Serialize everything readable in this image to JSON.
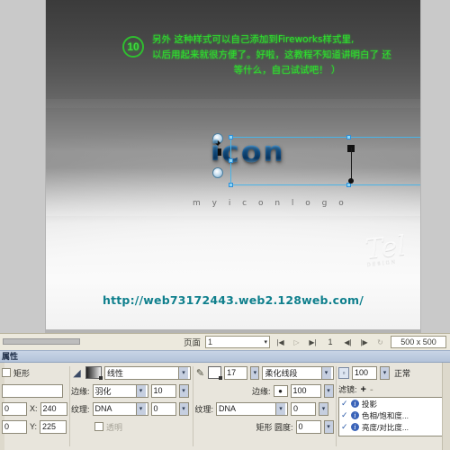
{
  "canvas": {
    "badge": "10",
    "annotation": {
      "line1": "另外  这种样式可以自己添加到Fireworks样式里,",
      "line2": "以后用起来就很方便了。好啦，这教程不知道讲明白了 还",
      "line3": "等什么，自己试试吧！  ）"
    },
    "logo": {
      "letters": [
        "i",
        "c",
        "o",
        "n"
      ],
      "tagline": "m y   i c o n   l o g o"
    },
    "watermark": {
      "text": "Tel",
      "sub": "DESIGN"
    },
    "url": "http://web73172443.web2.128web.com/"
  },
  "statusbar": {
    "page_label": "页面",
    "page_value": "1",
    "caret": "▾",
    "nav_first": "|◀",
    "nav_prev": "▷",
    "nav_last": "▶|",
    "current_page": "1",
    "anim_prev": "◀|",
    "anim_next": "|▶",
    "anim_loop": "↻",
    "dimensions": "500 x 500"
  },
  "properties": {
    "title": "属性",
    "object": {
      "type_label": "矩形",
      "name_value": "",
      "x_label": "X:",
      "x_value": "240",
      "y_label": "Y:",
      "y_value": "225",
      "w_value": "0",
      "h_value": "0"
    },
    "fill": {
      "icon": "paint-bucket-icon",
      "type": "线性",
      "edge_label": "边缘:",
      "edge_type": "羽化",
      "edge_amount": "10",
      "texture_label": "纹理:",
      "texture_name": "DNA",
      "texture_amount": "0",
      "transparent_label": "透明"
    },
    "stroke": {
      "icon": "pencil-icon",
      "size": "17",
      "type": "柔化线段",
      "edge_label": "边缘:",
      "edge_value": "100",
      "texture_label": "纹理:",
      "texture_name": "DNA",
      "texture_amount": "0",
      "roundness_label": "矩形 圆度:",
      "roundness_value": "0"
    },
    "effects": {
      "opacity_value": "100",
      "blend_mode": "正常",
      "filters_label": "滤镜:",
      "add_button": "+",
      "remove_button": "-",
      "filters": [
        {
          "checked": "✓",
          "info": "i",
          "name": "投影"
        },
        {
          "checked": "✓",
          "info": "i",
          "name": "色相/饱和度..."
        },
        {
          "checked": "✓",
          "info": "i",
          "name": "亮度/对比度..."
        }
      ]
    }
  },
  "colors": {
    "green_text": "#2ee02e",
    "url_teal": "#0f7f8c",
    "logo_blue": "#1b6fb8",
    "selection_blue": "#49b4e8",
    "panel_bg": "#e8e5dc"
  }
}
